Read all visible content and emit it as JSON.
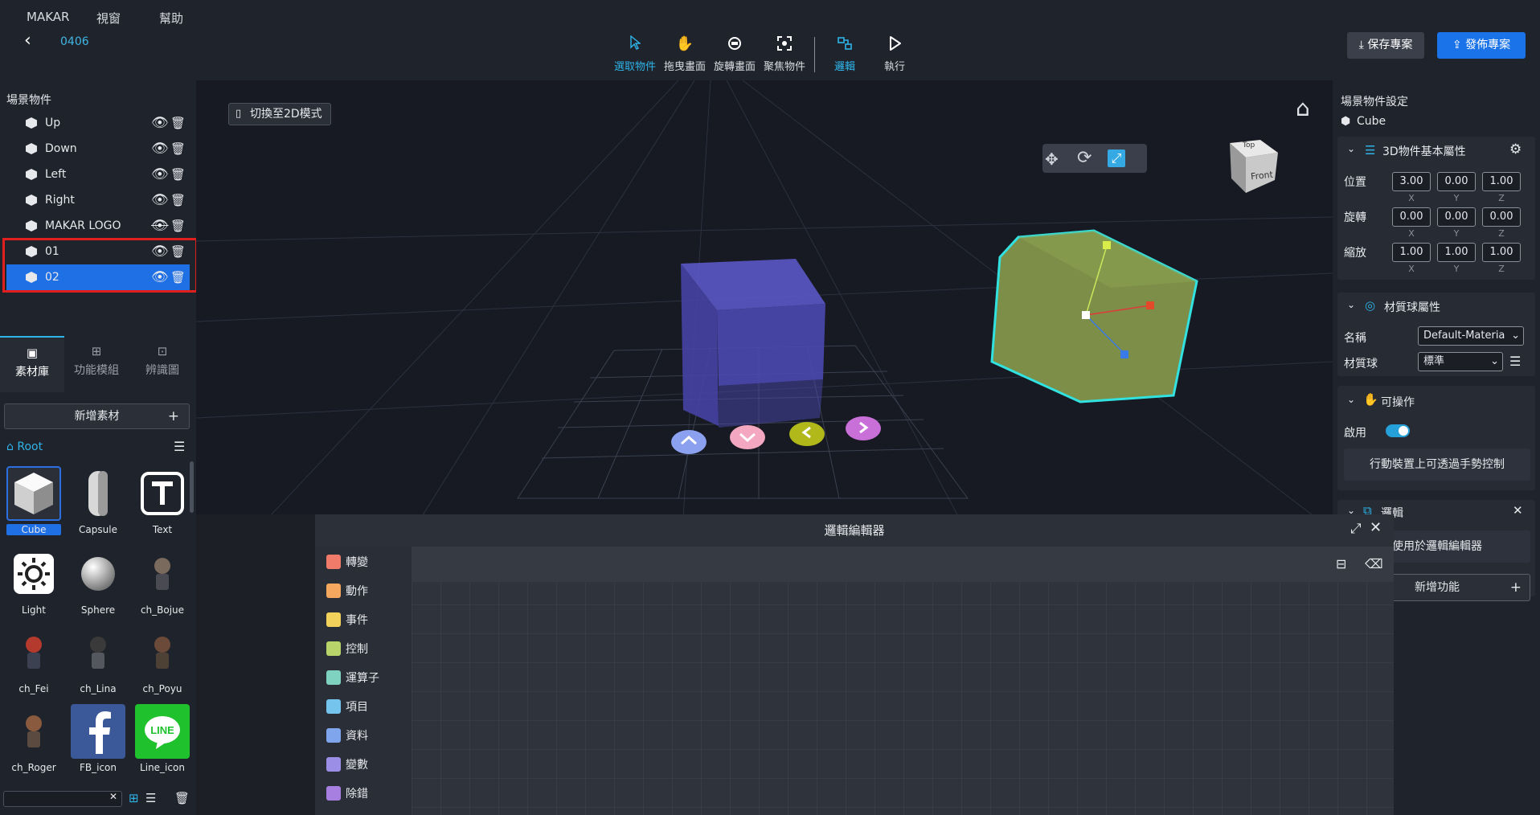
{
  "menu": {
    "items": [
      "MAKAR",
      "視窗",
      "幫助"
    ]
  },
  "project": {
    "name": "0406"
  },
  "toolbar": {
    "tools": [
      {
        "label": "選取物件",
        "icon": "cursor-icon",
        "active": true
      },
      {
        "label": "拖曳畫面",
        "icon": "hand-icon",
        "active": false
      },
      {
        "label": "旋轉畫面",
        "icon": "rotate-view-icon",
        "active": false
      },
      {
        "label": "聚焦物件",
        "icon": "focus-icon",
        "active": false
      },
      {
        "label": "邏輯",
        "icon": "logic-icon",
        "active": true
      },
      {
        "label": "執行",
        "icon": "play-icon",
        "active": false
      }
    ],
    "save_label": "保存專案",
    "publish_label": "發佈專案"
  },
  "scene": {
    "title": "場景物件",
    "objects": [
      {
        "label": "Up",
        "visible": true
      },
      {
        "label": "Down",
        "visible": true
      },
      {
        "label": "Left",
        "visible": true
      },
      {
        "label": "Right",
        "visible": true
      },
      {
        "label": "MAKAR LOGO",
        "visible": false
      },
      {
        "label": "01",
        "visible": true
      },
      {
        "label": "02",
        "visible": true,
        "selected": true
      }
    ]
  },
  "asset_tabs": [
    "素材庫",
    "功能模組",
    "辨識圖"
  ],
  "assets": {
    "add_label": "新增素材",
    "root_label": "Root",
    "items": [
      {
        "name": "Cube",
        "selected": true
      },
      {
        "name": "Capsule"
      },
      {
        "name": "Text"
      },
      {
        "name": "Light"
      },
      {
        "name": "Sphere"
      },
      {
        "name": "ch_Bojue"
      },
      {
        "name": "ch_Fei"
      },
      {
        "name": "ch_Lina"
      },
      {
        "name": "ch_Poyu"
      },
      {
        "name": "ch_Roger"
      },
      {
        "name": "FB_icon"
      },
      {
        "name": "Line_icon"
      }
    ]
  },
  "viewport": {
    "mode_button": "切換至2D模式",
    "view_cube_top": "Top",
    "view_cube_front": "Front"
  },
  "properties": {
    "title": "場景物件設定",
    "object_name": "Cube",
    "basic_section": "3D物件基本屬性",
    "position_label": "位置",
    "rotation_label": "旋轉",
    "scale_label": "縮放",
    "position": [
      "3.00",
      "0.00",
      "1.00"
    ],
    "rotation": [
      "0.00",
      "0.00",
      "0.00"
    ],
    "scale": [
      "1.00",
      "1.00",
      "1.00"
    ],
    "axes": [
      "X",
      "Y",
      "Z"
    ],
    "material_section": "材質球屬性",
    "material_name_label": "名稱",
    "material_name_value": "Default-Materia",
    "material_ball_label": "材質球",
    "material_ball_value": "標準",
    "interactive_section": "可操作",
    "enable_label": "啟用",
    "enabled": true,
    "gesture_button": "行動裝置上可透過手勢控制",
    "logic_section": "邏輯",
    "logic_use_button": "使用於邏輯編輯器",
    "add_function": "新增功能"
  },
  "logic_editor": {
    "title": "邏輯編輯器",
    "categories": [
      {
        "label": "轉變",
        "color": "#f07b6b"
      },
      {
        "label": "動作",
        "color": "#f3a75f"
      },
      {
        "label": "事件",
        "color": "#f2d25a"
      },
      {
        "label": "控制",
        "color": "#b8d36a"
      },
      {
        "label": "運算子",
        "color": "#7fd1c0"
      },
      {
        "label": "項目",
        "color": "#74c4ee"
      },
      {
        "label": "資料",
        "color": "#7fa6ec"
      },
      {
        "label": "變數",
        "color": "#9b8ee6"
      },
      {
        "label": "除錯",
        "color": "#a77fe0"
      }
    ]
  }
}
